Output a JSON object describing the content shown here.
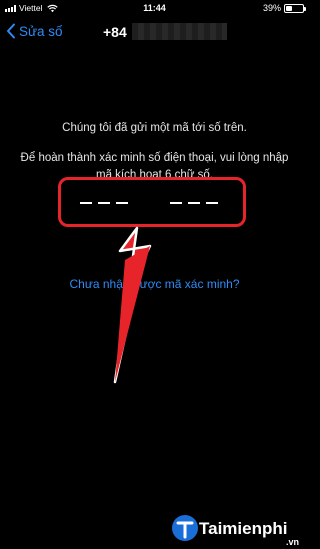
{
  "status_bar": {
    "carrier": "Viettel",
    "time": "11:44",
    "battery_percent": "39%",
    "battery_level": 0.39
  },
  "nav": {
    "back_label": "Sửa số",
    "phone_prefix": "+84"
  },
  "verification": {
    "sent_message": "Chúng tôi đã gửi một mã tới số trên.",
    "instruction": "Để hoàn thành xác minh số điện thoại, vui lòng nhập mã kích hoạt 6 chữ số.",
    "code_length": 6,
    "resend_link": "Chưa nhận được mã xác minh?"
  },
  "annotation": {
    "highlight_color": "#e8242b"
  },
  "watermark": {
    "text": "Taimienphi",
    "suffix": ".vn"
  },
  "colors": {
    "background": "#000000",
    "link": "#2e8cf6",
    "annotation": "#e8242b"
  }
}
